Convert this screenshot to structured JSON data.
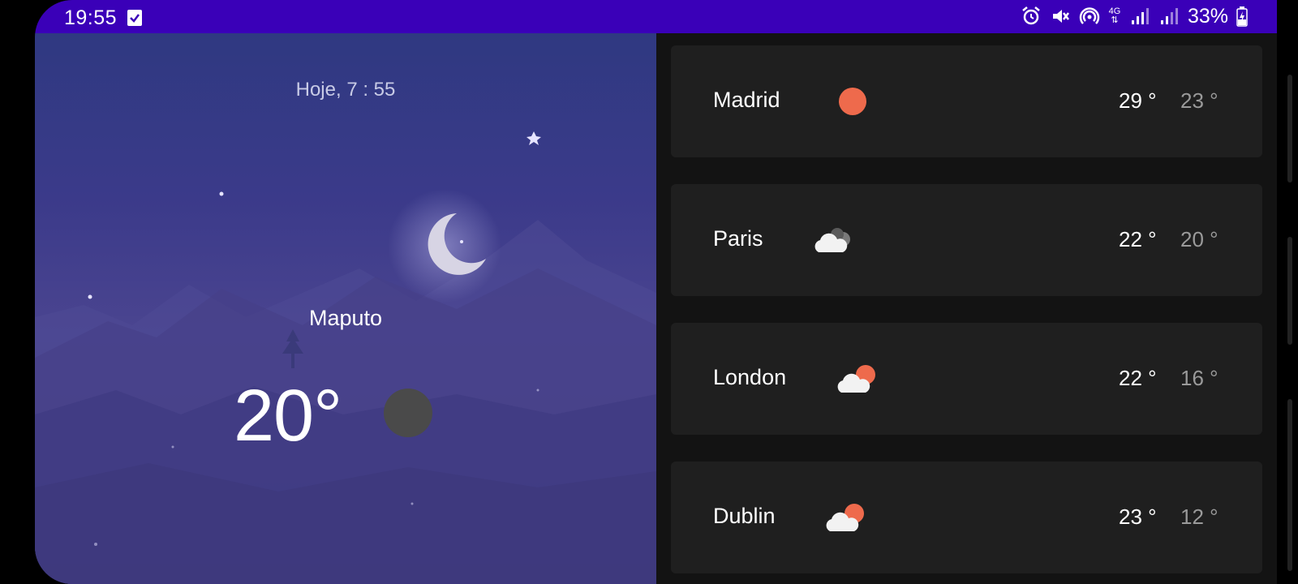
{
  "status_bar": {
    "time": "19:55",
    "network": "4G",
    "battery": "33%",
    "bar_color": "#3a00b8",
    "icons": [
      "alarm-icon",
      "mute-icon",
      "hotspot-icon",
      "network-4g-icon",
      "signal-icon",
      "signal-icon",
      "battery-charging-icon"
    ]
  },
  "current": {
    "date_time": "Hoje, 7 : 55",
    "city": "Maputo",
    "temperature": "20°",
    "scene": "night-mountains-moon"
  },
  "cities": [
    {
      "name": "Madrid",
      "icon": "sun-icon",
      "high": "29 °",
      "low": "23 °"
    },
    {
      "name": "Paris",
      "icon": "cloudy-icon",
      "high": "22 °",
      "low": "20 °"
    },
    {
      "name": "London",
      "icon": "partly-cloudy-icon",
      "high": "22 °",
      "low": "16 °"
    },
    {
      "name": "Dublin",
      "icon": "partly-cloudy-icon",
      "high": "23 °",
      "low": "12 °"
    }
  ],
  "colors": {
    "sun": "#ee6a4c",
    "card_bg": "#1f1f1f",
    "list_bg": "#131313"
  }
}
